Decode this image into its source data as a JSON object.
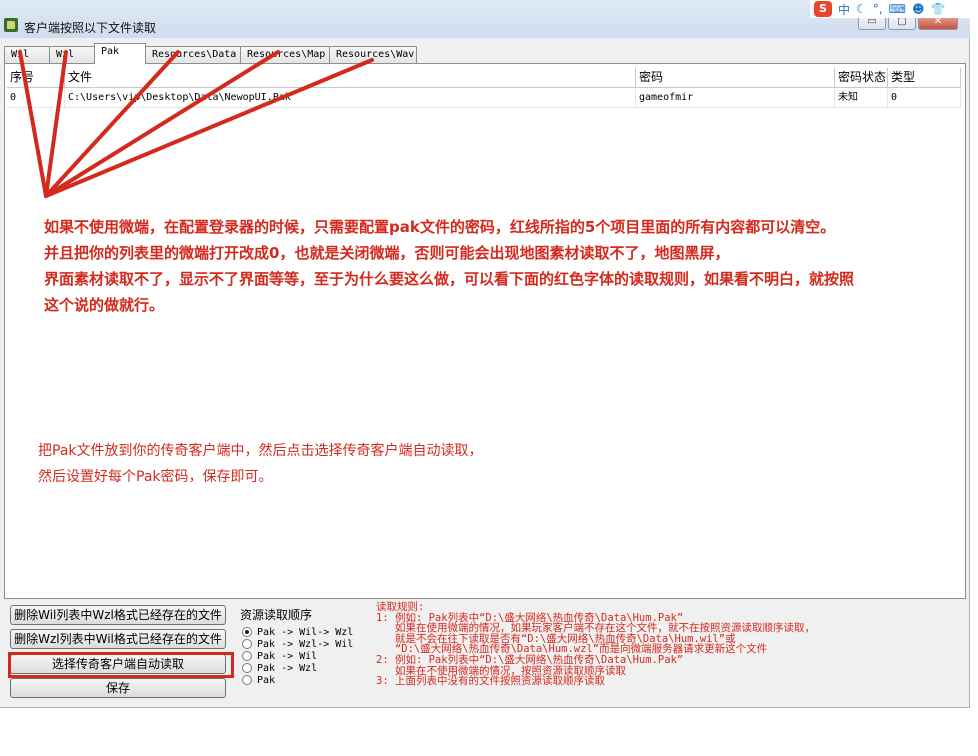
{
  "window": {
    "title": "客户端按照以下文件读取",
    "controls": {
      "minimize": "▭",
      "maximize": "▢",
      "close": "✕"
    }
  },
  "tray": {
    "sogou": "S",
    "ime": "中",
    "moon": "☾",
    "dots": "°,",
    "keyboard": "⌨",
    "user": "☻",
    "shirt": "👕"
  },
  "tabs": [
    "Wil",
    "Wzl",
    "Pak",
    "Resources\\Data",
    "Resources\\Map",
    "Resources\\Wav"
  ],
  "active_tab": "Pak",
  "table": {
    "headers": [
      "序号",
      "文件",
      "密码",
      "密码状态",
      "类型"
    ],
    "rows": [
      [
        "0",
        "C:\\Users\\vip\\Desktop\\Data\\NewopUI.Pak",
        "gameofmir",
        "未知",
        "0"
      ]
    ]
  },
  "annotation_main": [
    "如果不使用微端，在配置登录器的时候，只需要配置pak文件的密码，红线所指的5个项目里面的所有内容都可以清空。",
    "并且把你的列表里的微端打开改成0，也就是关闭微端，否则可能会出现地图素材读取不了，地图黑屏，",
    "界面素材读取不了，显示不了界面等等，至于为什么要这么做，可以看下面的红色字体的读取规则，如果看不明白，就按照",
    "这个说的做就行。"
  ],
  "annotation_secondary": [
    "把Pak文件放到你的传奇客户端中，然后点击选择传奇客户端自动读取，",
    "然后设置好每个Pak密码，保存即可。"
  ],
  "buttons": {
    "delete_wil": "删除Wil列表中Wzl格式已经存在的文件",
    "delete_wzl": "删除Wzl列表中Wil格式已经存在的文件",
    "auto_read": "选择传奇客户端自动读取",
    "save": "保存"
  },
  "resource_order": {
    "title": "资源读取顺序",
    "options": [
      "Pak -> Wil-> Wzl",
      "Pak -> Wzl-> Wil",
      "Pak -> Wil",
      "Pak -> Wzl",
      "Pak"
    ],
    "selected_index": 0
  },
  "rules": [
    "读取规则:",
    "1: 例如: Pak列表中“D:\\盛大网络\\热血传奇\\Data\\Hum.Pak”",
    "   如果在使用微端的情况，如果玩家客户端不存在这个文件，就不在按照资源读取顺序读取，",
    "   就是不会在往下读取是否有“D:\\盛大网络\\热血传奇\\Data\\Hum.wil”或",
    "   “D:\\盛大网络\\热血传奇\\Data\\Hum.wzl”而是向微端服务器请求更新这个文件",
    "2: 例如: Pak列表中“D:\\盛大网络\\热血传奇\\Data\\Hum.Pak”",
    "   如果在不使用微端的情况，按照资源读取顺序读取",
    "3: 上面列表中没有的文件按照资源读取顺序读取"
  ],
  "colors": {
    "annotation": "#d42a1e",
    "titlebar": "#dfe9f6"
  }
}
